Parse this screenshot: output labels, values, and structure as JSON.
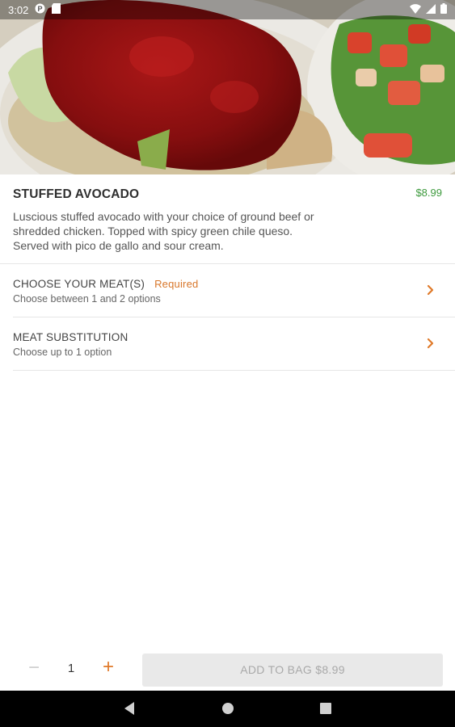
{
  "status_bar": {
    "time": "3:02",
    "icons": [
      "notification-p-icon",
      "sd-card-icon",
      "wifi-icon",
      "signal-icon",
      "battery-icon"
    ]
  },
  "hero": {
    "image": "stuffed-avocado-photo"
  },
  "item": {
    "title": "STUFFED AVOCADO",
    "price": "$8.99",
    "description": "Luscious stuffed avocado with your choice of ground beef or shredded chicken. Topped with spicy green chile queso. Served with pico de gallo and sour cream."
  },
  "options": [
    {
      "title": "CHOOSE YOUR MEAT(S)",
      "badge": "Required",
      "subtitle": "Choose between 1 and 2 options"
    },
    {
      "title": "MEAT SUBSTITUTION",
      "badge": "",
      "subtitle": "Choose up to 1 option"
    }
  ],
  "bottom_bar": {
    "quantity": "1",
    "minus": "−",
    "plus": "+",
    "add_label": "ADD TO BAG $8.99"
  },
  "nav": {
    "icons": [
      "back-icon",
      "home-icon",
      "recents-icon"
    ]
  },
  "colors": {
    "accent": "#e07a2a",
    "price": "#3d9a3d",
    "required": "#d8772b",
    "disabled_button": "#e9e9e9"
  }
}
